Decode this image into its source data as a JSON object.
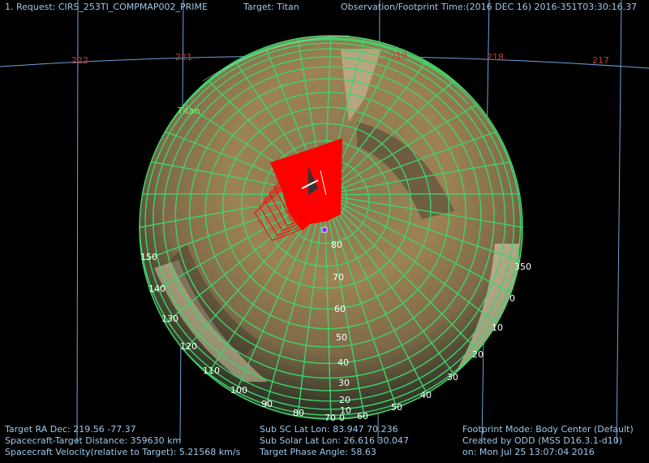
{
  "header": {
    "request": "1. Request: CIRS_253TI_COMPMAP002_PRIME",
    "target": "Target: Titan",
    "time": "Observation/Footprint Time:(2016 DEC 16) 2016-351T03:30:16.37"
  },
  "footer": {
    "left": [
      "Target RA Dec: 219.56  -77.37",
      "Spacecraft-Target Distance:  359630 km",
      "Spacecraft Velocity(relative to Target): 5.21568 km/s"
    ],
    "middle": [
      "Sub SC Lat Lon: 83.947  70.236",
      "Sub Solar Lat Lon: 26.616  30.047",
      "Target Phase Angle: 58.63"
    ],
    "right": [
      "Footprint Mode: Body Center (Default)",
      "Created by ODD (MSS D16.3.1-d10)",
      "on: Mon Jul 25 13:07:04 2016"
    ]
  },
  "sky_ra_labels": [
    "222",
    "221",
    "219",
    "218",
    "217"
  ],
  "body_label": "Titan",
  "lat_labels": [
    "80",
    "70",
    "60",
    "50",
    "40",
    "30",
    "20",
    "10",
    "0"
  ],
  "lon_labels_left": [
    "150",
    "140",
    "130",
    "120",
    "110",
    "100",
    "90",
    "80",
    "70"
  ],
  "lon_labels_right": [
    "350",
    "0",
    "10",
    "20",
    "30",
    "40",
    "50",
    "60"
  ],
  "colors": {
    "grid": "#3ed46a",
    "sky_grid": "#6ea2d8",
    "sky_label": "#c83a3a",
    "footprint": "#ff0000",
    "hud_text": "#9ec8e8",
    "label_green": "#6cff6c"
  }
}
